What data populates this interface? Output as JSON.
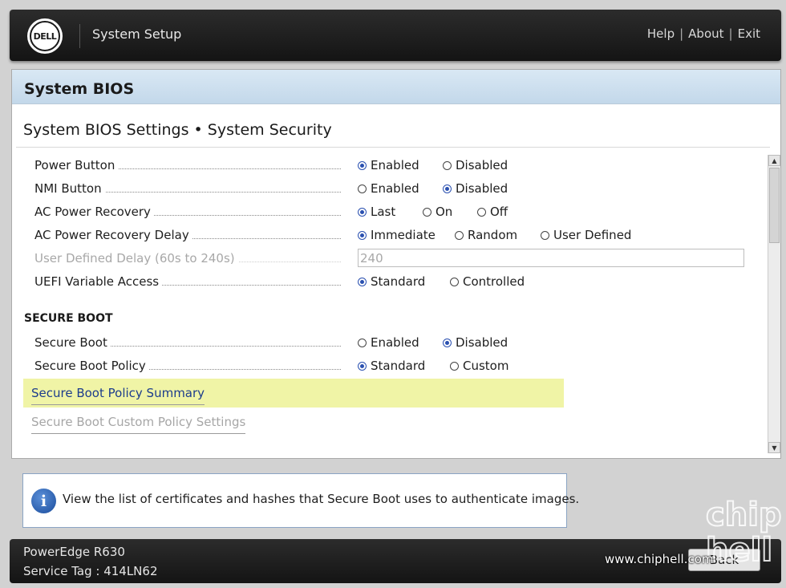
{
  "header": {
    "logo_text": "DELL",
    "title": "System Setup",
    "links": [
      "Help",
      "About",
      "Exit"
    ]
  },
  "panel": {
    "title": "System BIOS",
    "subtitle": "System BIOS Settings • System Security"
  },
  "settings": [
    {
      "label": "Power Button",
      "options": [
        {
          "text": "Enabled",
          "selected": true
        },
        {
          "text": "Disabled",
          "selected": false
        }
      ]
    },
    {
      "label": "NMI Button",
      "options": [
        {
          "text": "Enabled",
          "selected": false
        },
        {
          "text": "Disabled",
          "selected": true
        }
      ]
    },
    {
      "label": "AC Power Recovery",
      "options": [
        {
          "text": "Last",
          "selected": true
        },
        {
          "text": "On",
          "selected": false
        },
        {
          "text": "Off",
          "selected": false
        }
      ]
    },
    {
      "label": "AC Power Recovery Delay",
      "options": [
        {
          "text": "Immediate",
          "selected": true
        },
        {
          "text": "Random",
          "selected": false
        },
        {
          "text": "User Defined",
          "selected": false
        }
      ]
    },
    {
      "label": "User Defined Delay (60s to 240s)",
      "value": "240",
      "disabled": true
    },
    {
      "label": "UEFI Variable Access",
      "options": [
        {
          "text": "Standard",
          "selected": true
        },
        {
          "text": "Controlled",
          "selected": false
        }
      ]
    }
  ],
  "secure_boot": {
    "heading": "SECURE BOOT",
    "settings": [
      {
        "label": "Secure Boot",
        "options": [
          {
            "text": "Enabled",
            "selected": false
          },
          {
            "text": "Disabled",
            "selected": true
          }
        ]
      },
      {
        "label": "Secure Boot Policy",
        "options": [
          {
            "text": "Standard",
            "selected": true
          },
          {
            "text": "Custom",
            "selected": false
          }
        ]
      }
    ],
    "links": [
      {
        "text": "Secure Boot Policy Summary",
        "highlighted": true
      },
      {
        "text": "Secure Boot Custom Policy Settings",
        "disabled": true
      }
    ]
  },
  "help": {
    "icon": "info-icon",
    "text": "View the list of certificates and hashes that Secure Boot uses to authenticate images."
  },
  "footer": {
    "model": "PowerEdge R630",
    "service_tag": "Service Tag : 414LN62",
    "back_label": "Back"
  },
  "watermark": {
    "text": "www.chiphell.com",
    "logo": "chip hell"
  },
  "colors": {
    "header_bg": "#1f1f1f",
    "panel_band": "#cddfee",
    "highlight": "#f0f4a6",
    "radio_selected": "#2a50b0",
    "link_text": "#1c3c8c"
  }
}
